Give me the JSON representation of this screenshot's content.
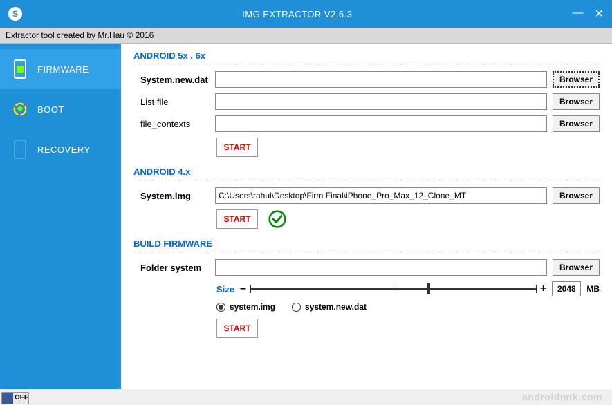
{
  "titlebar": {
    "logo_letter": "S",
    "title": "IMG EXTRACTOR V2.6.3"
  },
  "subtitle": "Extractor tool created by Mr.Hau © 2016",
  "sidebar": {
    "items": [
      {
        "label": "FIRMWARE"
      },
      {
        "label": "BOOT"
      },
      {
        "label": "RECOVERY"
      }
    ]
  },
  "sections": {
    "android56": {
      "header": "ANDROID 5x . 6x",
      "system_new_dat_label": "System.new.dat",
      "system_new_dat_value": "",
      "list_file_label": "List file",
      "list_file_value": "",
      "file_contexts_label": "file_contexts",
      "file_contexts_value": "",
      "browser": "Browser",
      "start": "START"
    },
    "android4": {
      "header": "ANDROID 4.x",
      "system_img_label": "System.img",
      "system_img_value": "C:\\Users\\rahul\\Desktop\\Firm Final\\iPhone_Pro_Max_12_Clone_MT",
      "browser": "Browser",
      "start": "START"
    },
    "build": {
      "header": "BUILD FIRMWARE",
      "folder_system_label": "Folder system",
      "folder_system_value": "",
      "browser": "Browser",
      "size_label": "Size",
      "size_value": "2048",
      "size_unit": "MB",
      "radio_system_img": "system.img",
      "radio_system_new_dat": "system.new.dat",
      "start": "START"
    }
  },
  "footer": {
    "off": "OFF",
    "watermark": "androidmtk.com"
  }
}
